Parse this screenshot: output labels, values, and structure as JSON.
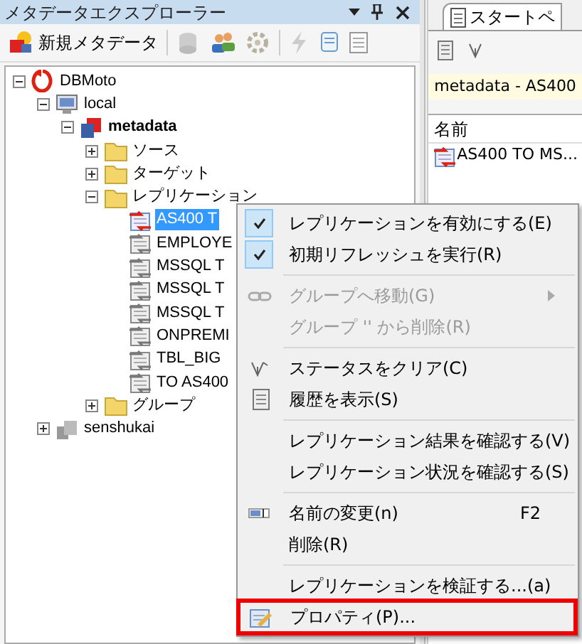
{
  "panel": {
    "title": "メタデータエクスプローラー"
  },
  "toolbar": {
    "new_label": "新規メタデータ"
  },
  "tree": [
    {
      "kind": "root",
      "label": "DBMoto",
      "expanded": true,
      "selected": false,
      "children": [
        {
          "kind": "server",
          "label": "local",
          "expanded": true,
          "selected": false,
          "children": [
            {
              "kind": "database",
              "label": "metadata",
              "expanded": true,
              "selected": false,
              "children": [
                {
                  "kind": "folder",
                  "label": "ソース",
                  "expanded": false,
                  "selected": false
                },
                {
                  "kind": "folder",
                  "label": "ターゲット",
                  "expanded": false,
                  "selected": false
                },
                {
                  "kind": "folder",
                  "label": "レプリケーション",
                  "expanded": true,
                  "selected": false,
                  "children": [
                    {
                      "kind": "active-replication",
                      "label": "AS400 T",
                      "selected": true
                    },
                    {
                      "kind": "replication",
                      "label": "EMPLOYE",
                      "selected": false
                    },
                    {
                      "kind": "replication",
                      "label": "MSSQL T",
                      "selected": false
                    },
                    {
                      "kind": "replication",
                      "label": "MSSQL T",
                      "selected": false
                    },
                    {
                      "kind": "replication",
                      "label": "MSSQL T",
                      "selected": false
                    },
                    {
                      "kind": "replication",
                      "label": "ONPREMI",
                      "selected": false
                    },
                    {
                      "kind": "replication",
                      "label": "TBL_BIG",
                      "selected": false
                    },
                    {
                      "kind": "replication",
                      "label": "TO AS400",
                      "selected": false
                    }
                  ]
                },
                {
                  "kind": "folder",
                  "label": "グループ",
                  "expanded": false,
                  "selected": false
                }
              ]
            }
          ]
        },
        {
          "kind": "server-group",
          "label": "senshukai",
          "expanded": false,
          "selected": false
        }
      ]
    }
  ],
  "menu": [
    {
      "kind": "item",
      "label": "レプリケーションを有効にする(E)",
      "checked": true,
      "disabled": false
    },
    {
      "kind": "item",
      "label": "初期リフレッシュを実行(R)",
      "checked": true,
      "disabled": false
    },
    {
      "kind": "separator"
    },
    {
      "kind": "item",
      "label": "グループへ移動(G)",
      "disabled": true,
      "submenu": true
    },
    {
      "kind": "item",
      "label": "グループ '' から削除(R)",
      "disabled": true
    },
    {
      "kind": "separator"
    },
    {
      "kind": "item",
      "label": "ステータスをクリア(C)",
      "disabled": false
    },
    {
      "kind": "item",
      "label": "履歴を表示(S)",
      "disabled": false
    },
    {
      "kind": "separator"
    },
    {
      "kind": "item",
      "label": "レプリケーション結果を確認する(V)",
      "disabled": false
    },
    {
      "kind": "item",
      "label": "レプリケーション状況を確認する(S)",
      "disabled": false
    },
    {
      "kind": "separator"
    },
    {
      "kind": "item",
      "label": "名前の変更(n)",
      "shortcut": "F2",
      "disabled": false
    },
    {
      "kind": "item",
      "label": "削除(R)",
      "disabled": false
    },
    {
      "kind": "separator"
    },
    {
      "kind": "item",
      "label": "レプリケーションを検証する...(a)",
      "disabled": false
    },
    {
      "kind": "item",
      "label": "プロパティ(P)...",
      "disabled": false,
      "highlighted": true
    }
  ],
  "right_panel": {
    "tab": "スタートペ",
    "filter_bar": "metadata - AS400",
    "column": "名前",
    "rows": [
      "AS400 TO MS..."
    ]
  }
}
